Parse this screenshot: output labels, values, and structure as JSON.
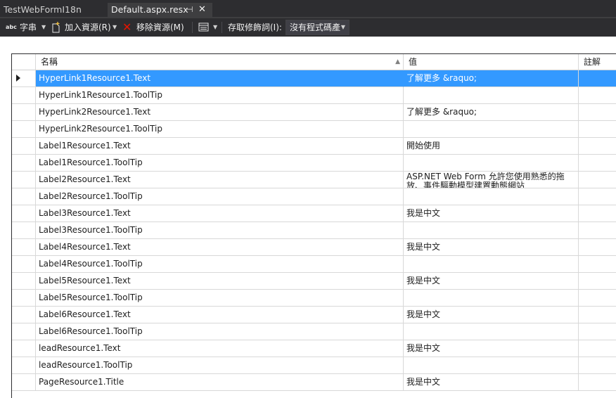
{
  "tabs": [
    {
      "label": "TestWebFormI18n",
      "active": false
    },
    {
      "label": "Default.aspx.resx",
      "active": true
    }
  ],
  "toolbar": {
    "strings_icon": "abc",
    "strings_label": "字串",
    "add_resource_label": "加入資源(R)",
    "remove_resource_label": "移除資源(M)",
    "access_modifier_label": "存取修飾詞(I):",
    "access_modifier_value": "沒有程式碼產"
  },
  "grid": {
    "columns": {
      "name": "名稱",
      "value": "值",
      "comment": "註解"
    },
    "rows": [
      {
        "name": "HyperLink1Resource1.Text",
        "value": "了解更多 &raquo;",
        "comment": ""
      },
      {
        "name": "HyperLink1Resource1.ToolTip",
        "value": "",
        "comment": ""
      },
      {
        "name": "HyperLink2Resource1.Text",
        "value": "了解更多 &raquo;",
        "comment": ""
      },
      {
        "name": "HyperLink2Resource1.ToolTip",
        "value": "",
        "comment": ""
      },
      {
        "name": "Label1Resource1.Text",
        "value": "開始使用",
        "comment": ""
      },
      {
        "name": "Label1Resource1.ToolTip",
        "value": "",
        "comment": ""
      },
      {
        "name": "Label2Resource1.Text",
        "value": "ASP.NET Web Form 允許您使用熟悉的拖放、事件驅動模型建置動態網站",
        "comment": ""
      },
      {
        "name": "Label2Resource1.ToolTip",
        "value": "",
        "comment": ""
      },
      {
        "name": "Label3Resource1.Text",
        "value": "我是中文",
        "comment": ""
      },
      {
        "name": "Label3Resource1.ToolTip",
        "value": "",
        "comment": ""
      },
      {
        "name": "Label4Resource1.Text",
        "value": "我是中文",
        "comment": ""
      },
      {
        "name": "Label4Resource1.ToolTip",
        "value": "",
        "comment": ""
      },
      {
        "name": "Label5Resource1.Text",
        "value": "我是中文",
        "comment": ""
      },
      {
        "name": "Label5Resource1.ToolTip",
        "value": "",
        "comment": ""
      },
      {
        "name": "Label6Resource1.Text",
        "value": "我是中文",
        "comment": ""
      },
      {
        "name": "Label6Resource1.ToolTip",
        "value": "",
        "comment": ""
      },
      {
        "name": "leadResource1.Text",
        "value": "我是中文",
        "comment": ""
      },
      {
        "name": "leadResource1.ToolTip",
        "value": "",
        "comment": ""
      },
      {
        "name": "PageResource1.Title",
        "value": "我是中文",
        "comment": ""
      }
    ]
  },
  "icons": {
    "pin": "pin-icon",
    "close": "close-icon",
    "add_resource": "add-resource-icon",
    "remove_resource": "remove-resource-icon",
    "view": "view-icon"
  },
  "colors": {
    "selection": "#3399ff",
    "remove_icon": "#e51400",
    "chrome": "#2d2d30"
  }
}
